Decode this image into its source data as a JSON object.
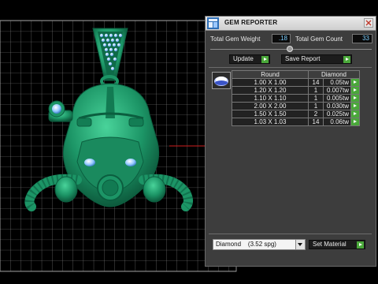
{
  "panel": {
    "title": "GEM REPORTER",
    "total_weight_label": "Total Gem Weight",
    "total_weight_value": ".18",
    "total_count_label": "Total Gem Count",
    "total_count_value": "33",
    "update_label": "Update",
    "save_report_label": "Save Report",
    "table": {
      "col_shape": "Round",
      "col_material": "Diamond",
      "rows": [
        {
          "size": "1.00 X 1.00",
          "qty": "14",
          "weight": "0.05tw"
        },
        {
          "size": "1.20 X 1.20",
          "qty": "1",
          "weight": "0.007tw"
        },
        {
          "size": "1.10 X 1.10",
          "qty": "1",
          "weight": "0.005tw"
        },
        {
          "size": "2.00 X 2.00",
          "qty": "1",
          "weight": "0.030tw"
        },
        {
          "size": "1.50 X 1.50",
          "qty": "2",
          "weight": "0.025tw"
        },
        {
          "size": "1.03 X 1.03",
          "qty": "14",
          "weight": "0.06tw"
        }
      ]
    },
    "material_select_value": "Diamond    (3.52 spg)",
    "set_material_label": "Set Material"
  },
  "icons": {
    "app": "gem-reporter-app-icon",
    "close": "close-icon",
    "gem": "round-gem-icon"
  },
  "colors": {
    "model": "#1f9a6e",
    "accent_green": "#4aa83a",
    "value_text": "#7fd0ff",
    "grid": "#9a9a9a"
  }
}
